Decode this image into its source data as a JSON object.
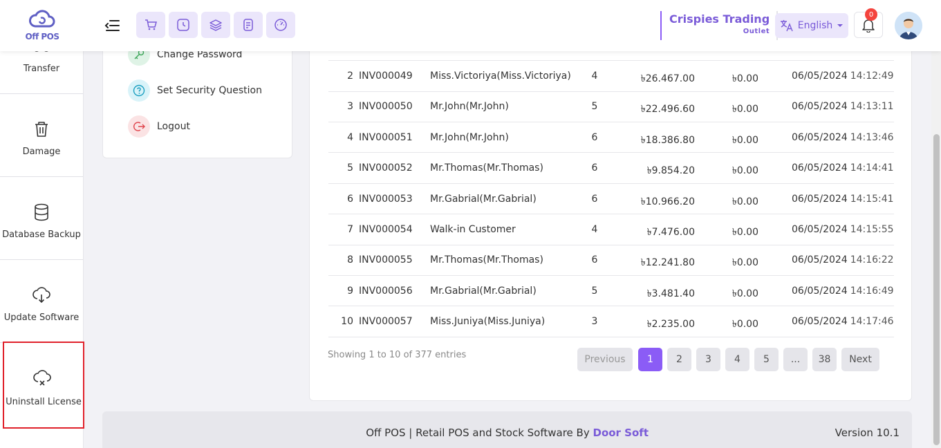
{
  "header": {
    "logo_text": "Off POS",
    "outlet_name": "Crispies Trading",
    "outlet_sub": "Outlet",
    "language": "English",
    "notification_count": "0"
  },
  "sidebar": {
    "items": [
      {
        "label": "Transfer",
        "icon": "transfer-icon"
      },
      {
        "label": "Damage",
        "icon": "trash-icon"
      },
      {
        "label": "Database Backup",
        "icon": "database-icon"
      },
      {
        "label": "Update Software",
        "icon": "cloud-download-icon"
      },
      {
        "label": "Uninstall License",
        "icon": "cloud-x-icon"
      }
    ]
  },
  "profile_menu": {
    "change_password": "Change Password",
    "security_question": "Set Security Question",
    "logout": "Logout"
  },
  "table": {
    "rows": [
      {
        "sn": "2",
        "invoice": "INV000049",
        "customer": "Miss.Victoriya(Miss.Victoriya)",
        "qty": "4",
        "total": "৳26.467.00",
        "due": "৳0.00",
        "date": "06/05/2024",
        "time": "14:12:49"
      },
      {
        "sn": "3",
        "invoice": "INV000050",
        "customer": "Mr.John(Mr.John)",
        "qty": "5",
        "total": "৳22.496.60",
        "due": "৳0.00",
        "date": "06/05/2024",
        "time": "14:13:11"
      },
      {
        "sn": "4",
        "invoice": "INV000051",
        "customer": "Mr.John(Mr.John)",
        "qty": "6",
        "total": "৳18.386.80",
        "due": "৳0.00",
        "date": "06/05/2024",
        "time": "14:13:46"
      },
      {
        "sn": "5",
        "invoice": "INV000052",
        "customer": "Mr.Thomas(Mr.Thomas)",
        "qty": "6",
        "total": "৳9.854.20",
        "due": "৳0.00",
        "date": "06/05/2024",
        "time": "14:14:41"
      },
      {
        "sn": "6",
        "invoice": "INV000053",
        "customer": "Mr.Gabrial(Mr.Gabrial)",
        "qty": "6",
        "total": "৳10.966.20",
        "due": "৳0.00",
        "date": "06/05/2024",
        "time": "14:15:41"
      },
      {
        "sn": "7",
        "invoice": "INV000054",
        "customer": "Walk-in Customer",
        "qty": "4",
        "total": "৳7.476.00",
        "due": "৳0.00",
        "date": "06/05/2024",
        "time": "14:15:55"
      },
      {
        "sn": "8",
        "invoice": "INV000055",
        "customer": "Mr.Thomas(Mr.Thomas)",
        "qty": "6",
        "total": "৳12.241.80",
        "due": "৳0.00",
        "date": "06/05/2024",
        "time": "14:16:22"
      },
      {
        "sn": "9",
        "invoice": "INV000056",
        "customer": "Mr.Gabrial(Mr.Gabrial)",
        "qty": "5",
        "total": "৳3.481.40",
        "due": "৳0.00",
        "date": "06/05/2024",
        "time": "14:16:49"
      },
      {
        "sn": "10",
        "invoice": "INV000057",
        "customer": "Miss.Juniya(Miss.Juniya)",
        "qty": "3",
        "total": "৳2.235.00",
        "due": "৳0.00",
        "date": "06/05/2024",
        "time": "14:17:46"
      }
    ],
    "showing_text": "Showing 1 to 10 of 377 entries"
  },
  "pagination": {
    "previous": "Previous",
    "pages": [
      "1",
      "2",
      "3",
      "4",
      "5",
      "...",
      "38"
    ],
    "next": "Next",
    "active_page": "1"
  },
  "footer": {
    "text": "Off POS | Retail POS and Stock Software By",
    "link": "Door Soft",
    "version": "Version 10.1"
  },
  "colors": {
    "accent": "#8b5cf6",
    "brand_text": "#7a5bd8",
    "badge": "#f4433d",
    "selected_border": "#e0202a"
  }
}
